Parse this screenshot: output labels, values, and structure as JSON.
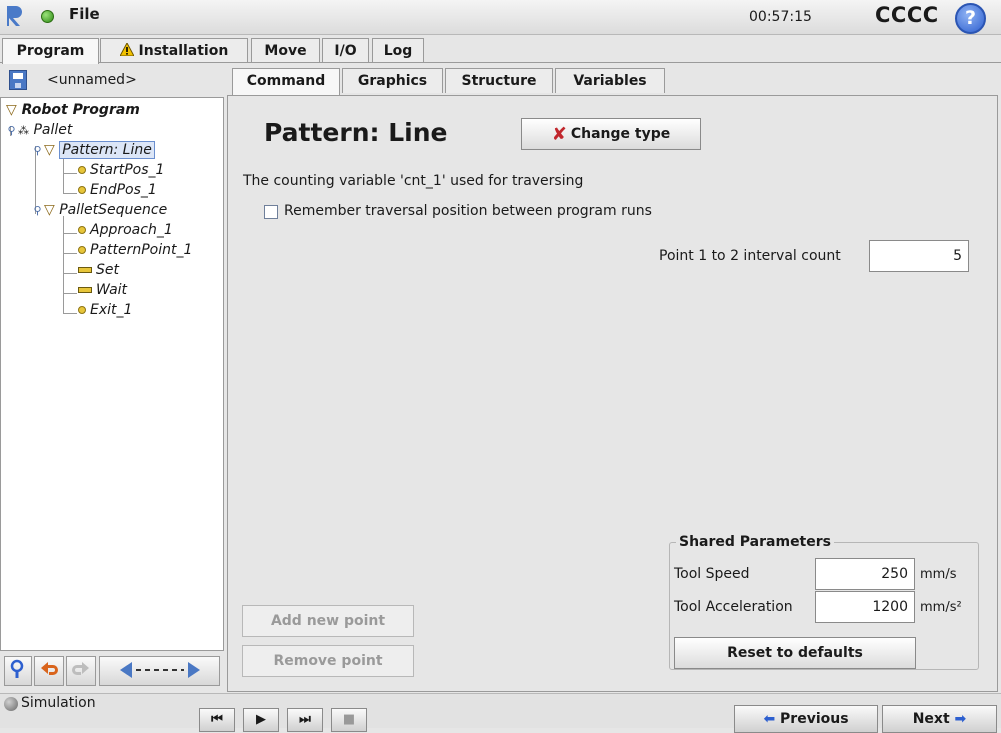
{
  "titlebar": {
    "menu_label": "File",
    "clock": "00:57:15",
    "robot_name": "CCCC",
    "help_glyph": "?"
  },
  "top_tabs": [
    {
      "label": "Program",
      "active": true
    },
    {
      "label": "Installation",
      "icon": "warning-icon"
    },
    {
      "label": "Move"
    },
    {
      "label": "I/O"
    },
    {
      "label": "Log"
    }
  ],
  "program": {
    "name": "<unnamed>"
  },
  "tree": {
    "root": "Robot Program",
    "items": [
      {
        "label": "Pallet",
        "icon": "pallet-icon"
      },
      {
        "label": "Pattern: Line",
        "icon": "folder-triangle-icon",
        "selected": true
      },
      {
        "label": "StartPos_1",
        "icon": "waypoint-icon"
      },
      {
        "label": "EndPos_1",
        "icon": "waypoint-icon"
      },
      {
        "label": "PalletSequence",
        "icon": "folder-triangle-icon"
      },
      {
        "label": "Approach_1",
        "icon": "waypoint-icon"
      },
      {
        "label": "PatternPoint_1",
        "icon": "waypoint-icon"
      },
      {
        "label": "Set",
        "icon": "set-icon"
      },
      {
        "label": "Wait",
        "icon": "wait-icon"
      },
      {
        "label": "Exit_1",
        "icon": "waypoint-icon"
      }
    ]
  },
  "tree_toolbar": {
    "icons": [
      "search-icon",
      "undo-icon",
      "redo-icon",
      "cut-drag-icon"
    ]
  },
  "content_tabs": [
    {
      "label": "Command",
      "active": true
    },
    {
      "label": "Graphics"
    },
    {
      "label": "Structure"
    },
    {
      "label": "Variables"
    }
  ],
  "command": {
    "title": "Pattern: Line",
    "change_type_label": "Change type",
    "counting_text": "The counting variable 'cnt_1' used for traversing",
    "remember_label": "Remember traversal position between program runs",
    "remember_checked": false,
    "interval_label": "Point 1 to 2 interval count",
    "interval_value": "5",
    "add_point_label": "Add new point",
    "remove_point_label": "Remove point"
  },
  "shared_parameters": {
    "title": "Shared Parameters",
    "tool_speed_label": "Tool Speed",
    "tool_speed_value": "250",
    "tool_speed_unit": "mm/s",
    "tool_accel_label": "Tool Acceleration",
    "tool_accel_value": "1200",
    "tool_accel_unit": "mm/s²",
    "reset_label": "Reset to defaults"
  },
  "bottom": {
    "simulation_label": "Simulation",
    "previous_label": "Previous",
    "next_label": "Next"
  },
  "colors": {
    "accent_blue": "#2d5fcf",
    "warning_yellow": "#f2c200",
    "status_green": "#3fa81c",
    "waypoint_yellow": "#e7c53a",
    "close_red": "#c1272d"
  }
}
